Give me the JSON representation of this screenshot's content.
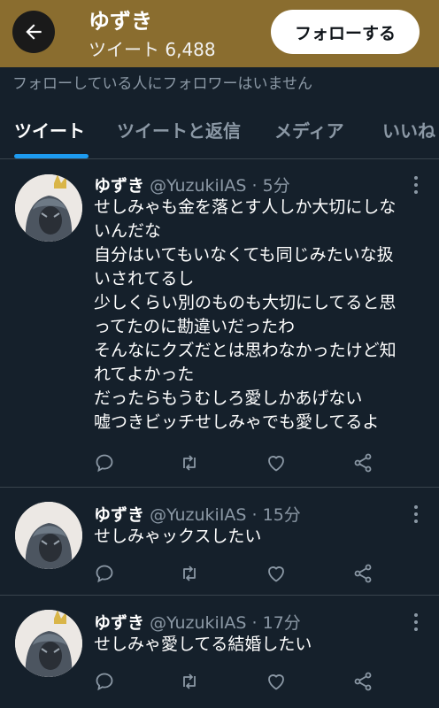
{
  "header": {
    "name": "ゆずき",
    "tweet_count": "ツイート 6,488",
    "follow_label": "フォローする"
  },
  "notice": "フォローしている人にフォロワーはいません",
  "tabs": [
    {
      "label": "ツイート"
    },
    {
      "label": "ツイートと返信"
    },
    {
      "label": "メディア"
    },
    {
      "label": "いいね"
    }
  ],
  "tweets": [
    {
      "name": "ゆずき",
      "meta": "@YuzukiIAS · 5分",
      "lines": [
        "せしみゃも金を落とす人しか大切にしな",
        "いんだな",
        "自分はいてもいなくても同じみたいな扱",
        "いされてるし",
        "少しくらい別のものも大切にしてると思",
        "ってたのに勘違いだったわ",
        "そんなにクズだとは思わなかったけど知",
        "れてよかった",
        "だったらもうむしろ愛しかあげない",
        "嘘つきビッチせしみゃでも愛してるよ"
      ]
    },
    {
      "name": "ゆずき",
      "meta": "@YuzukiIAS · 15分",
      "lines": [
        "せしみゃックスしたい"
      ]
    },
    {
      "name": "ゆずき",
      "meta": "@YuzukiIAS · 17分",
      "lines": [
        "せしみゃ愛してる結婚したい"
      ]
    }
  ],
  "icons": {
    "back": "arrow-left-icon",
    "more": "more-vertical-icon",
    "reply": "reply-icon",
    "retweet": "retweet-icon",
    "like": "heart-icon",
    "share": "share-icon"
  },
  "colors": {
    "header_bg": "#8a6d2f",
    "page_bg": "#15202b",
    "accent": "#1d9bf0",
    "muted": "#8b98a5",
    "divider": "#38444d"
  }
}
